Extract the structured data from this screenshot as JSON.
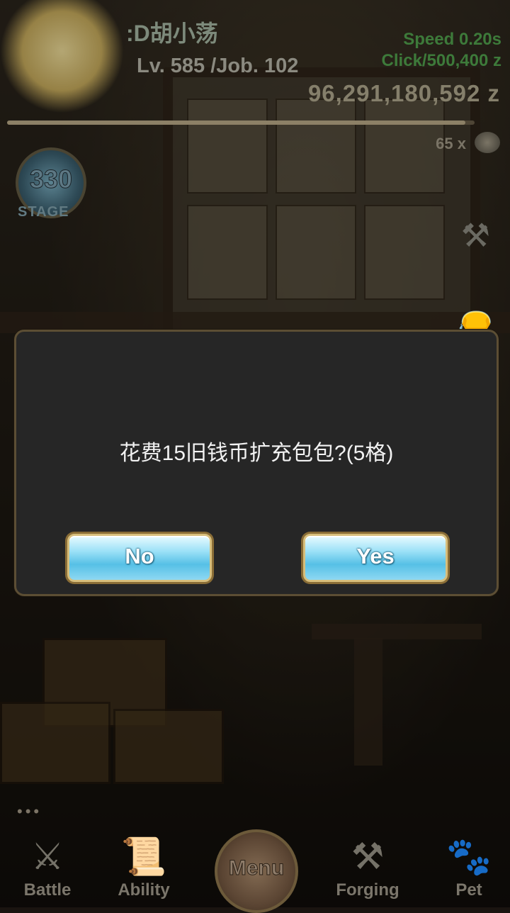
{
  "header": {
    "player_name": ":D胡小荡",
    "level": "Lv. 585 /Job. 102",
    "speed": "Speed 0.20s",
    "click_rate": "Click/500,400 z",
    "gold": "96,291,180,592 z",
    "coins": "65 x",
    "stage_number": "330",
    "stage_label": "STAGE",
    "progress": 0.98
  },
  "dialog": {
    "message": "花费15旧钱币扩充包包?(5格)",
    "no_label": "No",
    "yes_label": "Yes"
  },
  "page_dots": "•••",
  "nav": {
    "battle": "Battle",
    "ability": "Ability",
    "menu": "Menu",
    "forging": "Forging",
    "pet": "Pet"
  }
}
